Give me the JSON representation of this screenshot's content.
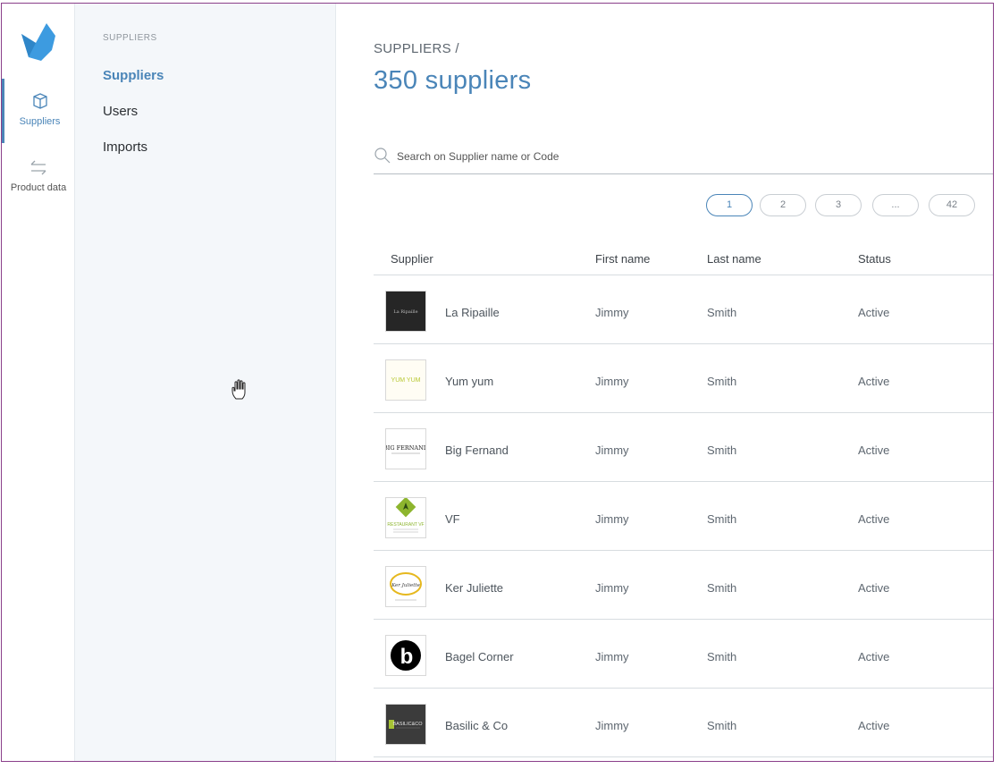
{
  "rail": {
    "items": [
      {
        "label": "Suppliers",
        "icon": "box-icon",
        "active": true
      },
      {
        "label": "Product data",
        "icon": "arrows-exchange-icon",
        "active": false
      }
    ]
  },
  "subnav": {
    "heading": "SUPPLIERS",
    "items": [
      {
        "label": "Suppliers",
        "active": true
      },
      {
        "label": "Users",
        "active": false
      },
      {
        "label": "Imports",
        "active": false
      }
    ]
  },
  "main": {
    "breadcrumb": "SUPPLIERS /",
    "title": "350 suppliers",
    "search": {
      "placeholder": "Search on Supplier name or Code",
      "value": ""
    },
    "pagination": [
      "1",
      "2",
      "3",
      "...",
      "42"
    ],
    "current_page": "1",
    "columns": {
      "supplier": "Supplier",
      "first_name": "First name",
      "last_name": "Last name",
      "status": "Status"
    },
    "rows": [
      {
        "name": "La Ripaille",
        "first": "Jimmy",
        "last": "Smith",
        "status": "Active",
        "logo_text": "La Ripaille",
        "logo": "dark"
      },
      {
        "name": "Yum yum",
        "first": "Jimmy",
        "last": "Smith",
        "status": "Active",
        "logo_text": "YUM YUM",
        "logo": "yum"
      },
      {
        "name": "Big Fernand",
        "first": "Jimmy",
        "last": "Smith",
        "status": "Active",
        "logo_text": "BIG FERNAND",
        "logo": "bigf"
      },
      {
        "name": "VF",
        "first": "Jimmy",
        "last": "Smith",
        "status": "Active",
        "logo_text": "RESTAURANT VF",
        "logo": "vf"
      },
      {
        "name": "Ker Juliette",
        "first": "Jimmy",
        "last": "Smith",
        "status": "Active",
        "logo_text": "Ker Juliette",
        "logo": "ker"
      },
      {
        "name": "Bagel Corner",
        "first": "Jimmy",
        "last": "Smith",
        "status": "Active",
        "logo_text": "b",
        "logo": "bagel"
      },
      {
        "name": "Basilic & Co",
        "first": "Jimmy",
        "last": "Smith",
        "status": "Active",
        "logo_text": "BASILIC&CO",
        "logo": "basilic"
      }
    ]
  },
  "colors": {
    "accent": "#4a85b8",
    "logo_blue": "#3d9be0"
  }
}
